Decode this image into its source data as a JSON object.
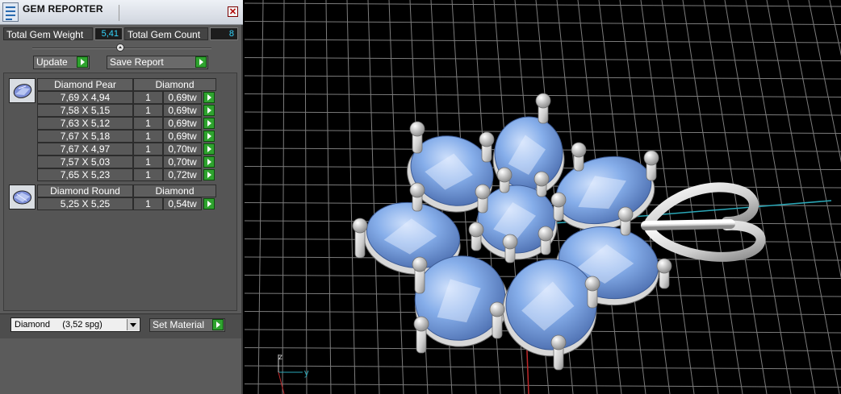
{
  "panel": {
    "title": "GEM REPORTER",
    "close_glyph": "✕",
    "total_weight_label": "Total Gem Weight",
    "total_weight_value": "5,41",
    "total_count_label": "Total Gem Count",
    "total_count_value": "8",
    "update_label": "Update",
    "save_report_label": "Save Report",
    "groups": [
      {
        "shape": "Diamond Pear",
        "material": "Diamond",
        "rows": [
          {
            "size": "7,69 X 4,94",
            "qty": "1",
            "weight": "0,69tw"
          },
          {
            "size": "7,58 X 5,15",
            "qty": "1",
            "weight": "0,69tw"
          },
          {
            "size": "7,63 X 5,12",
            "qty": "1",
            "weight": "0,69tw"
          },
          {
            "size": "7,67 X 5,18",
            "qty": "1",
            "weight": "0,69tw"
          },
          {
            "size": "7,67 X 4,97",
            "qty": "1",
            "weight": "0,70tw"
          },
          {
            "size": "7,57 X 5,03",
            "qty": "1",
            "weight": "0,70tw"
          },
          {
            "size": "7,65 X 5,23",
            "qty": "1",
            "weight": "0,72tw"
          }
        ]
      },
      {
        "shape": "Diamond Round",
        "material": "Diamond",
        "rows": [
          {
            "size": "5,25 X 5,25",
            "qty": "1",
            "weight": "0,54tw"
          }
        ]
      }
    ],
    "material_select": "Diamond     (3,52 spg)",
    "set_material_label": "Set Material"
  },
  "viewport": {
    "axis_z": "z",
    "axis_y": "y"
  },
  "colors": {
    "value_text": "#33d6ff",
    "gem_blue": "#7aa6e6",
    "metal": "#e4e4e4",
    "grid": "#8a8a8a",
    "go_button": "#2fa32f"
  }
}
